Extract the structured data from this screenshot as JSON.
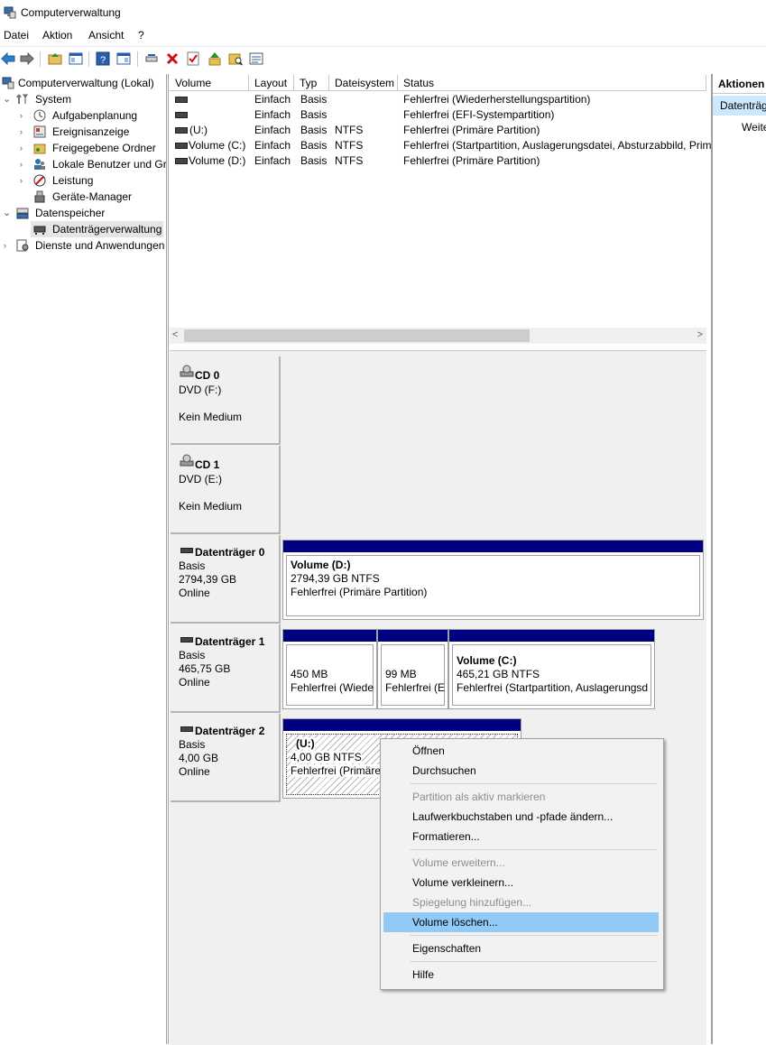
{
  "window": {
    "title": "Computerverwaltung"
  },
  "menubar": {
    "items": [
      "Datei",
      "Aktion",
      "Ansicht",
      "?"
    ]
  },
  "tree": {
    "root": "Computerverwaltung (Lokal)",
    "system": "System",
    "aufgabenplanung": "Aufgabenplanung",
    "ereignisanzeige": "Ereignisanzeige",
    "freigegebene_ordner": "Freigegebene Ordner",
    "lokale_benutzer": "Lokale Benutzer und Gru",
    "leistung": "Leistung",
    "geraete_manager": "Geräte-Manager",
    "datenspeicher": "Datenspeicher",
    "datentraegerverwaltung": "Datenträgerverwaltung",
    "dienste": "Dienste und Anwendungen"
  },
  "volume_list": {
    "columns": [
      "Volume",
      "Layout",
      "Typ",
      "Dateisystem",
      "Status"
    ],
    "rows": [
      {
        "volume": "",
        "layout": "Einfach",
        "typ": "Basis",
        "fs": "",
        "status": "Fehlerfrei (Wiederherstellungspartition)"
      },
      {
        "volume": "",
        "layout": "Einfach",
        "typ": "Basis",
        "fs": "",
        "status": "Fehlerfrei (EFI-Systempartition)"
      },
      {
        "volume": "(U:)",
        "layout": "Einfach",
        "typ": "Basis",
        "fs": "NTFS",
        "status": "Fehlerfrei (Primäre Partition)"
      },
      {
        "volume": "Volume (C:)",
        "layout": "Einfach",
        "typ": "Basis",
        "fs": "NTFS",
        "status": "Fehlerfrei (Startpartition, Auslagerungsdatei, Absturzabbild, Prim"
      },
      {
        "volume": "Volume (D:)",
        "layout": "Einfach",
        "typ": "Basis",
        "fs": "NTFS",
        "status": "Fehlerfrei (Primäre Partition)"
      }
    ]
  },
  "disks": {
    "cd0": {
      "name": "CD 0",
      "line1": "DVD (F:)",
      "line2": "Kein Medium"
    },
    "cd1": {
      "name": "CD 1",
      "line1": "DVD (E:)",
      "line2": "Kein Medium"
    },
    "disk0": {
      "name": "Datenträger 0",
      "type": "Basis",
      "size": "2794,39 GB",
      "state": "Online",
      "partitions": [
        {
          "title": "Volume  (D:)",
          "size": "2794,39 GB NTFS",
          "status": "Fehlerfrei (Primäre Partition)"
        }
      ]
    },
    "disk1": {
      "name": "Datenträger 1",
      "type": "Basis",
      "size": "465,75 GB",
      "state": "Online",
      "partitions": [
        {
          "size": "450 MB",
          "status": "Fehlerfrei (Wiede"
        },
        {
          "size": "99 MB",
          "status": "Fehlerfrei (E"
        },
        {
          "title": "Volume  (C:)",
          "size": "465,21 GB NTFS",
          "status": "Fehlerfrei (Startpartition, Auslagerungsd"
        }
      ]
    },
    "disk2": {
      "name": "Datenträger 2",
      "type": "Basis",
      "size": "4,00 GB",
      "state": "Online",
      "partitions": [
        {
          "title": "(U:)",
          "size": "4,00 GB NTFS",
          "status": "Fehlerfrei (Primäre"
        }
      ]
    }
  },
  "actions": {
    "header": "Aktionen",
    "selected": "Datenträg",
    "more": "Weite"
  },
  "context_menu": {
    "items": [
      {
        "label": "Öffnen",
        "enabled": true
      },
      {
        "label": "Durchsuchen",
        "enabled": true
      },
      {
        "label": "Partition als aktiv markieren",
        "enabled": false
      },
      {
        "label": "Laufwerkbuchstaben und -pfade ändern...",
        "enabled": true
      },
      {
        "label": "Formatieren...",
        "enabled": true
      },
      {
        "label": "Volume erweitern...",
        "enabled": false
      },
      {
        "label": "Volume verkleinern...",
        "enabled": true
      },
      {
        "label": "Spiegelung hinzufügen...",
        "enabled": false
      },
      {
        "label": "Volume löschen...",
        "enabled": true,
        "highlighted": true
      },
      {
        "label": "Eigenschaften",
        "enabled": true
      },
      {
        "label": "Hilfe",
        "enabled": true
      }
    ]
  },
  "colors": {
    "partition_bar": "#000080",
    "highlight": "#91c9f7",
    "selection": "#cce8ff"
  }
}
